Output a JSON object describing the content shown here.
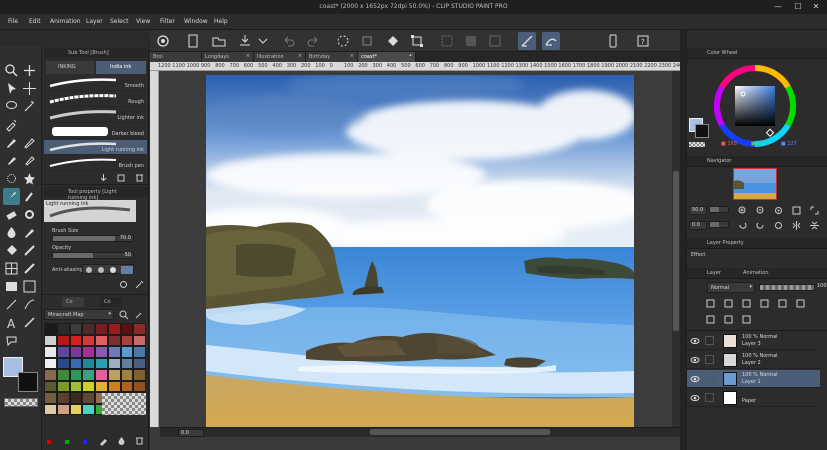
{
  "window": {
    "title": "coast* (2000 x 1652px 72dpi 50.0%) - CLIP STUDIO PAINT PRO",
    "controls": [
      "—",
      "☐",
      "✕"
    ]
  },
  "menu": [
    "File",
    "Edit",
    "Animation",
    "Layer",
    "Select",
    "View",
    "Filter",
    "Window",
    "Help"
  ],
  "subtool": {
    "tab": "Sub Tool [Brush]",
    "groups": [
      "INKING",
      "India ink"
    ],
    "brushes": [
      {
        "label": "Smooth"
      },
      {
        "label": "Rough"
      },
      {
        "label": "Lighter ink"
      },
      {
        "label": "Darker bleed"
      },
      {
        "label": "Light running ink"
      },
      {
        "label": "Brush pen"
      }
    ]
  },
  "tool_property": {
    "tab": "Tool property [Light running ink]",
    "preview_label": "Light running ink",
    "brush_size_label": "Brush Size",
    "brush_size_value": "70.0",
    "opacity_label": "Opacity",
    "opacity_value": "50",
    "antialiasing_label": "Anti-aliasing"
  },
  "color_set": {
    "tabs": [
      "Co",
      "Co"
    ],
    "selected_set": "Minecraft Map",
    "swatches": [
      "#1a1a1a",
      "#2b2b2b",
      "#3d3d3d",
      "#4f2a2a",
      "#7a1f1f",
      "#9b1b1b",
      "#5b1010",
      "#8a2a2a",
      "#cfcfcf",
      "#b51919",
      "#d42020",
      "#d13a3a",
      "#e06060",
      "#7a3030",
      "#a84040",
      "#c86a6a",
      "#e8e8e8",
      "#5a4a9a",
      "#7a3a9a",
      "#a3309a",
      "#8a5ab0",
      "#6a7ac0",
      "#5a9ad0",
      "#4a7aa8",
      "#f0f0f0",
      "#2a4a8a",
      "#3a6ab0",
      "#1e8a9a",
      "#2aa0b0",
      "#9ab0c0",
      "#6080a0",
      "#4a6080",
      "#8a6a4a",
      "#3a8a3a",
      "#2a9a5a",
      "#3aa080",
      "#e060a0",
      "#c0a060",
      "#a08040",
      "#806030",
      "#5a5a30",
      "#7a9a20",
      "#a0c030",
      "#d0d020",
      "#e0b030",
      "#d08020",
      "#b06020",
      "#905020",
      "#706040",
      "#5a4030",
      "#3a2a20",
      "#604838",
      "#907050",
      "#b09070",
      "#c0b090",
      "#d8d0b0",
      "#e0c8a0",
      "#d0a080",
      "#e8d060",
      "#50d0c0",
      "#30b030",
      "#2060d0",
      "#9060d0",
      "#d0d0d0"
    ]
  },
  "tabs": [
    {
      "label": "Brol"
    },
    {
      "label": "Longdays"
    },
    {
      "label": "Illustration"
    },
    {
      "label": "Birthday"
    },
    {
      "label": "coast*"
    }
  ],
  "ruler": [
    "1200",
    "1100",
    "1000",
    "900",
    "800",
    "700",
    "600",
    "500",
    "400",
    "300",
    "200",
    "100",
    "0",
    "100",
    "200",
    "300",
    "400",
    "500",
    "600",
    "700",
    "800",
    "900",
    "1000",
    "1100",
    "1200",
    "1300",
    "1400",
    "1500",
    "1600",
    "1700",
    "1800",
    "1900",
    "2000",
    "2100",
    "2200",
    "2300",
    "2400"
  ],
  "status": {
    "zoom": "0.0"
  },
  "color_wheel": {
    "tab": "Color Wheel",
    "r": "168",
    "g": "191",
    "b": "227",
    "current_color": "#a8bfe3"
  },
  "navigator": {
    "tab": "Navigator",
    "zoom": "50.0",
    "rotation": "0.0"
  },
  "layer_property": {
    "tab": "Layer Property",
    "effect_label": "Effect"
  },
  "layer_panel": {
    "tabs": [
      "Layer",
      "Animation"
    ],
    "blend_mode": "Normal",
    "opacity": "100",
    "layers": [
      {
        "mode": "100 % Normal",
        "name": "Layer 3",
        "thumb": "#e8e0d8"
      },
      {
        "mode": "100 % Normal",
        "name": "Layer 2",
        "thumb": "#d8d8d8"
      },
      {
        "mode": "100 % Normal",
        "name": "Layer 1",
        "thumb": "#6a9ad0",
        "active": true
      },
      {
        "mode": "",
        "name": "Paper",
        "thumb": "#ffffff"
      }
    ]
  },
  "colors": {
    "accent_active": "#4c5e77",
    "tool_active": "#3d7d8a",
    "main_color": "#a8bfe3"
  }
}
